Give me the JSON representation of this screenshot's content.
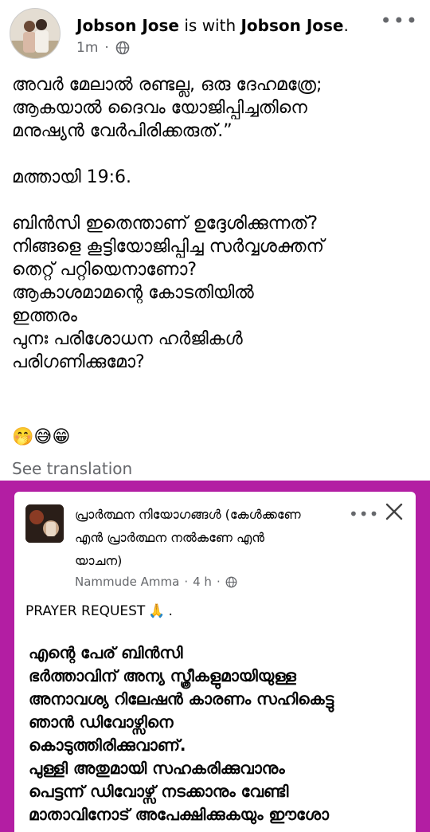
{
  "post": {
    "author": "Jobson Jose",
    "connector": " is with ",
    "tagged": "Jobson Jose",
    "period": ".",
    "time": "1m",
    "separator": "·",
    "privacy_icon": "globe-icon",
    "more_icon": "ellipsis-icon",
    "text_lines": [
      "അവർ മേലാൽ രണ്ടല്ല, ഒരു ദേഹമത്രേ;",
      "ആകയാൽ ദൈവം യോജിപ്പിച്ചതിനെ",
      "മനുഷ്യൻ വേർപിരിക്കരുത്.”",
      "",
      "മത്തായി 19:6.",
      "",
      "ബിൻസി ഇതെന്താണ് ഉദ്ദേശിക്കുന്നത്?",
      "നിങ്ങളെ കൂട്ടിയോജിപ്പിച്ച സർവ്വശക്തന്",
      "തെറ്റ് പറ്റിയെനാണോ?",
      "ആകാശമാമന്റെ കോടതിയിൽ",
      "ഇത്തരം",
      "പുനഃ പരിശോധന ഹർജികൾ",
      "പരിഗണിക്കുമോ?"
    ],
    "emojis": "🤭😅😁",
    "see_translation": "See translation"
  },
  "shared": {
    "frame_color": "#b31ea3",
    "group_title_lines": [
      "പ്രാർത്ഥന നിയോഗങ്ങൾ (കേൾക്കണേ",
      "എൻ പ്രാർത്ഥന നൽകണേ എൻ",
      "യാചന)"
    ],
    "group_author": "Nammude Amma",
    "group_time": "4 h",
    "separator": "·",
    "more_icon": "ellipsis-icon",
    "close_icon": "close-icon",
    "prayer_heading": "PRAYER REQUEST",
    "prayer_emoji": "🙏",
    "prayer_heading_end": ".",
    "prayer_lines": [
      "എന്റെ പേര് ബിൻസി",
      "ഭർത്താവിന് അന്യ സ്ത്രീകളുമായിയുള്ള",
      "അനാവശ്യ റിലേഷൻ കാരണം സഹികെട്ടു",
      "ഞാൻ ഡിവോഴ്സിനെ",
      "കൊടുത്തിരിക്കുവാണ്.",
      "പുള്ളി അതുമായി സഹകരിക്കുവാനും",
      "പെട്ടന്ന് ഡിവോഴ്സ് നടക്കാനും വേണ്ടി",
      "മാതാവിനോട് അപേക്ഷിക്കുകയും ഈശോ"
    ]
  }
}
